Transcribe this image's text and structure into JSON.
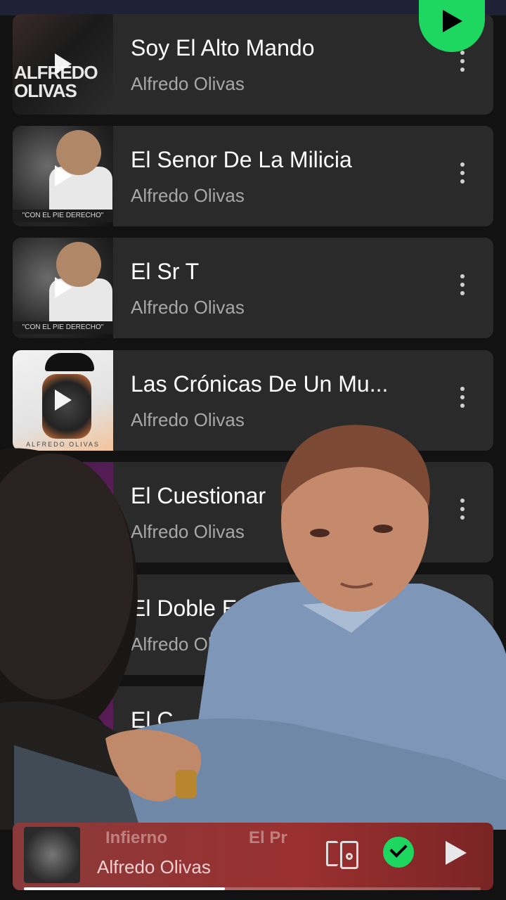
{
  "songs": [
    {
      "title": "Soy El Alto Mando",
      "artist": "Alfredo Olivas",
      "art_text": "ALFREDO OLIVAS"
    },
    {
      "title": "El Senor De La Milicia",
      "artist": "Alfredo Olivas",
      "art_text": "\"CON EL PIE DERECHO\""
    },
    {
      "title": "El Sr T",
      "artist": "Alfredo Olivas",
      "art_text": "\"CON EL PIE DERECHO\""
    },
    {
      "title": "Las Crónicas De Un Mu...",
      "artist": "Alfredo Olivas",
      "art_text": "ALFREDO OLIVAS"
    },
    {
      "title": "El Cuestionar",
      "artist": "Alfredo Olivas"
    },
    {
      "title": "El Doble Equ",
      "artist": "Alfredo Olivas"
    },
    {
      "title": "El C",
      "artist": ""
    }
  ],
  "now_playing": {
    "title": "Infierno",
    "next_title": "El Pr",
    "artist": "Alfredo Olivas",
    "progress": 0.44
  },
  "icons": {
    "shuffle_play": "play-icon",
    "more": "more-vertical-icon",
    "devices": "devices-icon",
    "liked": "check-icon",
    "play": "play-icon"
  },
  "colors": {
    "accent": "#1ed760",
    "background": "#121212",
    "row": "#2a2a2a",
    "player": "#8a3a3a"
  }
}
